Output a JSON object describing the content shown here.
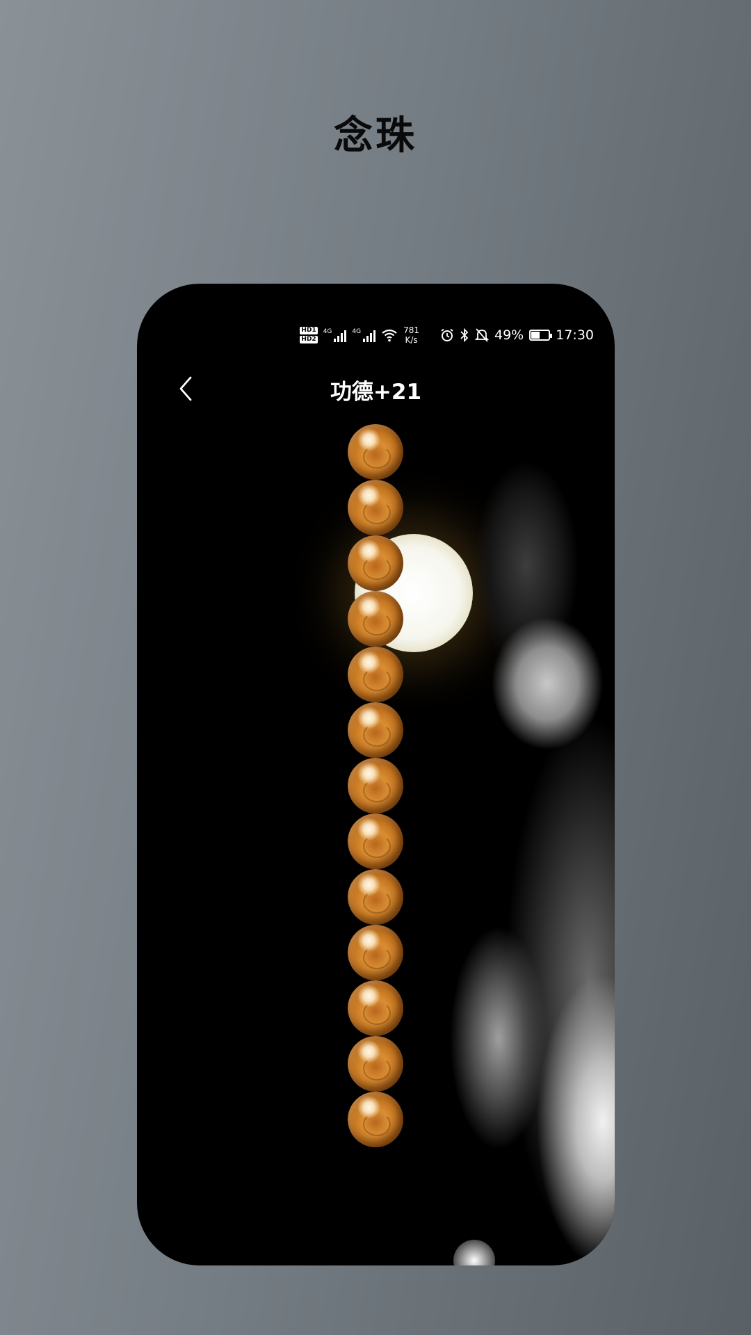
{
  "promo": {
    "title": "念珠"
  },
  "status_bar": {
    "hd1": "HD1",
    "hd2": "HD2",
    "net1": "4G",
    "net2": "4G",
    "speed_value": "781",
    "speed_unit": "K/s",
    "battery": "49%",
    "battery_level": 0.49,
    "time": "17:30",
    "icons": [
      "wifi-icon",
      "alarm-icon",
      "bluetooth-icon",
      "mute-bell-icon",
      "battery-charging-icon"
    ]
  },
  "nav": {
    "title": "功德+21",
    "back_icon": "chevron-left-icon"
  },
  "beads": {
    "visible_count": 13
  }
}
